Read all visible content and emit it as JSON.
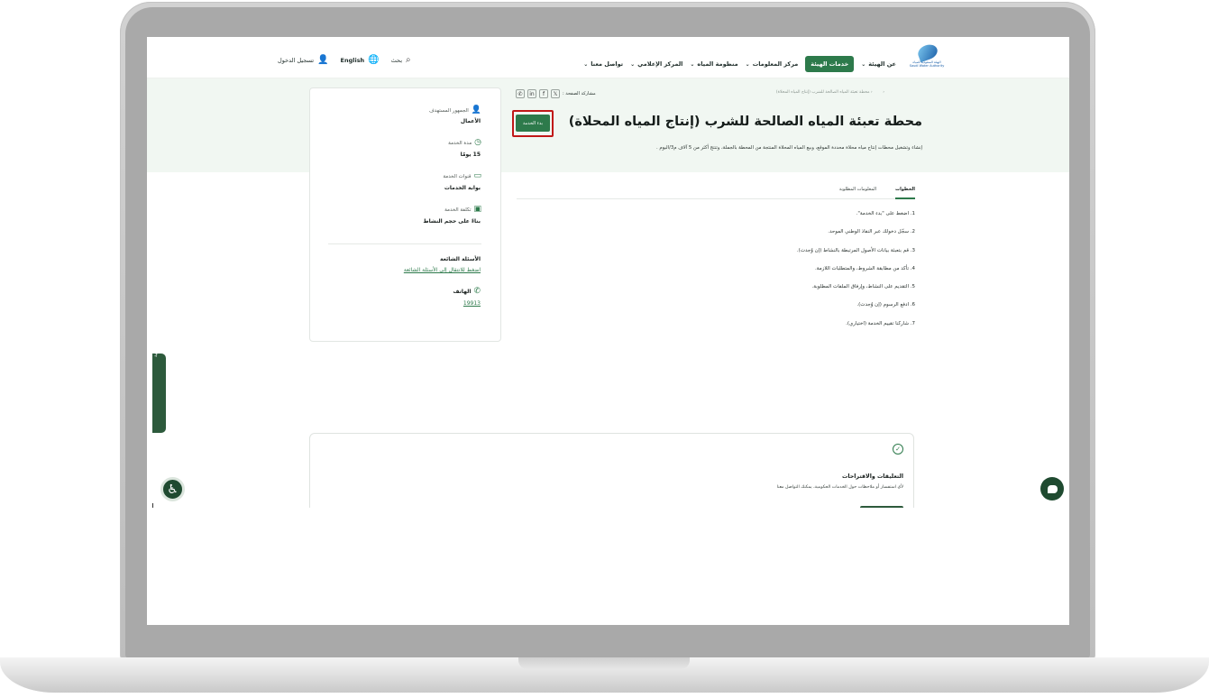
{
  "header": {
    "logo": {
      "icon": "water-drop-logo",
      "caption": "الهيئة السعودية للمياه Saudi Water Authority"
    },
    "nav": [
      {
        "label": "عن الهيئة",
        "dropdown": true,
        "active": false
      },
      {
        "label": "خدمات الهيئة",
        "dropdown": false,
        "active": true
      },
      {
        "label": "مركز المعلومات",
        "dropdown": true,
        "active": false
      },
      {
        "label": "منظومة المياه",
        "dropdown": true,
        "active": false
      },
      {
        "label": "المركز الإعلامي",
        "dropdown": true,
        "active": false
      },
      {
        "label": "تواصل معنا",
        "dropdown": true,
        "active": false
      }
    ],
    "search_label": "بحث",
    "language_label": "English",
    "login_label": "تسجيل الدخول"
  },
  "hero": {
    "breadcrumb": "محطة تعبئة المياه الصالحة للشرب (إنتاج المياه المحلاة)",
    "share_label": "مشاركة الصفحة :",
    "share_icons": [
      "x-icon",
      "facebook-icon",
      "linkedin-icon",
      "whatsapp-icon"
    ],
    "title": "محطة تعبئة المياه الصالحة للشرب (إنتاج المياه المحلاة)",
    "start_button": "بدء الخدمة",
    "description": "إنشاء وتشغيل محطات إنتاج مياه محلاة محددة الموقع، وبيع المياه المحلاة المنتجة من المحطة بالجملة، وتنتج أكثر من 5 آلاف م3/اليوم ."
  },
  "tabs": [
    {
      "label": "الخطوات",
      "active": true
    },
    {
      "label": "المعلومات المطلوبة",
      "active": false
    }
  ],
  "steps": [
    "1. اضغط على \"بدء الخدمة\".",
    "2. سجّل دخولك عبر النفاذ الوطني الموحد.",
    "3. قم بتعبئة بيانات الأصول المرتبطة بالنشاط (إن وُجدت).",
    "4. تأكد من مطابقة الشروط، والمتطلبات اللازمة.",
    "5. التقديم على النشاط، وإرفاق الملفات المطلوبة.",
    "6. ادفع الرسوم (إن وُجدت).",
    "7. شاركنا تقييم الخدمة (اختياري)."
  ],
  "info_card": {
    "audience_label": "الجمهور المستهدف",
    "audience_value": "الأعمال",
    "duration_label": "مدة الخدمة",
    "duration_value": "15 يومًا",
    "channels_label": "قنوات الخدمة",
    "channels_value": "بوابة الخدمات",
    "cost_label": "تكلفة الخدمة",
    "cost_value": "بناءً على حجم النشاط",
    "faq_title": "الأسئلة الشائعة",
    "faq_link": "اضغط للانتقال إلى الأسئلة الشائعة",
    "phone_label": "الهاتف",
    "phone_value": "19913"
  },
  "side_tab_label": "قيم التجربة الرقمية",
  "feedback": {
    "title": "التعليقات والاقتراحات",
    "text": "لأي استفسار أو ملاحظات حول الخدمات الحكومية، يمكنك التواصل معنا"
  },
  "colors": {
    "primary_green": "#2d7a4b",
    "hero_bg": "#f1f7f2",
    "highlight_red": "#c01818",
    "dark_green": "#1f4a30"
  }
}
